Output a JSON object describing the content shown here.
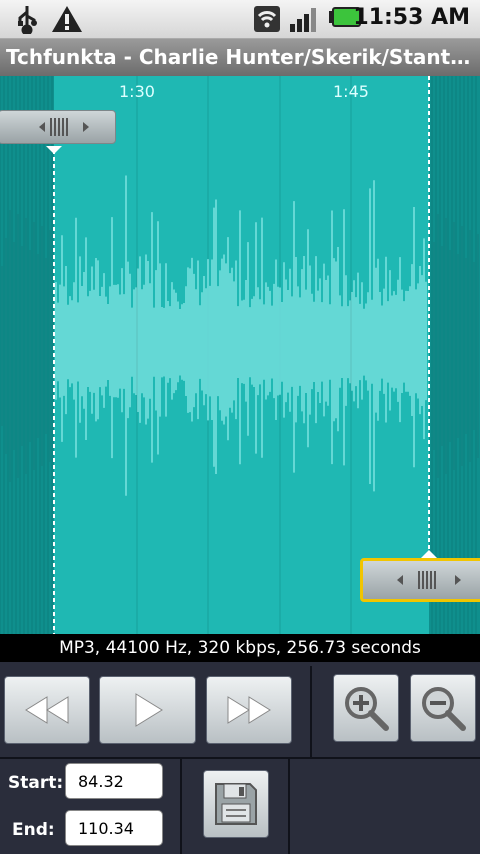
{
  "status_bar": {
    "time": "11:53 AM",
    "icons": [
      "usb-icon",
      "warning-icon",
      "wifi-icon",
      "signal-icon",
      "battery-icon"
    ]
  },
  "title": "Tchfunkta - Charlie Hunter/Skerik/Stanton M...",
  "waveform": {
    "time_labels": [
      "1:30",
      "1:45"
    ],
    "colors": {
      "background": "#19a7a2",
      "selected": "#1fb8b3",
      "wave": "#b8ffff",
      "handle_highlight": "#f1c500"
    }
  },
  "info": "MP3, 44100 Hz, 320 kbps, 256.73 seconds",
  "editor": {
    "start_label": "Start:",
    "start_value": "84.32",
    "end_label": "End:",
    "end_value": "110.34"
  }
}
